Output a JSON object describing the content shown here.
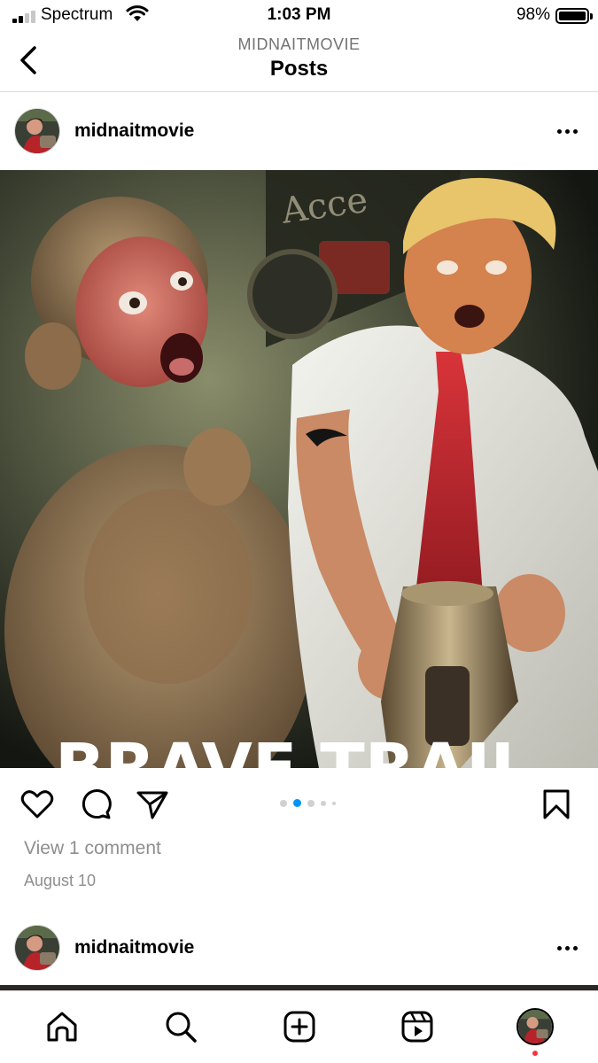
{
  "status_bar": {
    "carrier": "Spectrum",
    "time": "1:03 PM",
    "battery": "98%",
    "battery_level": 0.98,
    "signal_bars_filled": 2,
    "signal_bars_total": 4
  },
  "header": {
    "account": "MIDNAITMOVIE",
    "title": "Posts"
  },
  "post": {
    "username": "midnaitmovie",
    "image_caption_fragment": "BRAVE TRAIL",
    "carousel": {
      "count": 5,
      "active_index": 1
    },
    "view_comments": "View 1 comment",
    "date": "August 10"
  },
  "next_post": {
    "username": "midnaitmovie"
  },
  "tabbar": {
    "items": [
      "home-icon",
      "search-icon",
      "create-icon",
      "reels-icon",
      "profile-avatar"
    ]
  },
  "colors": {
    "accent_blue": "#0095f6",
    "notification_red": "#ff3040",
    "muted_text": "#8e8e8e"
  }
}
